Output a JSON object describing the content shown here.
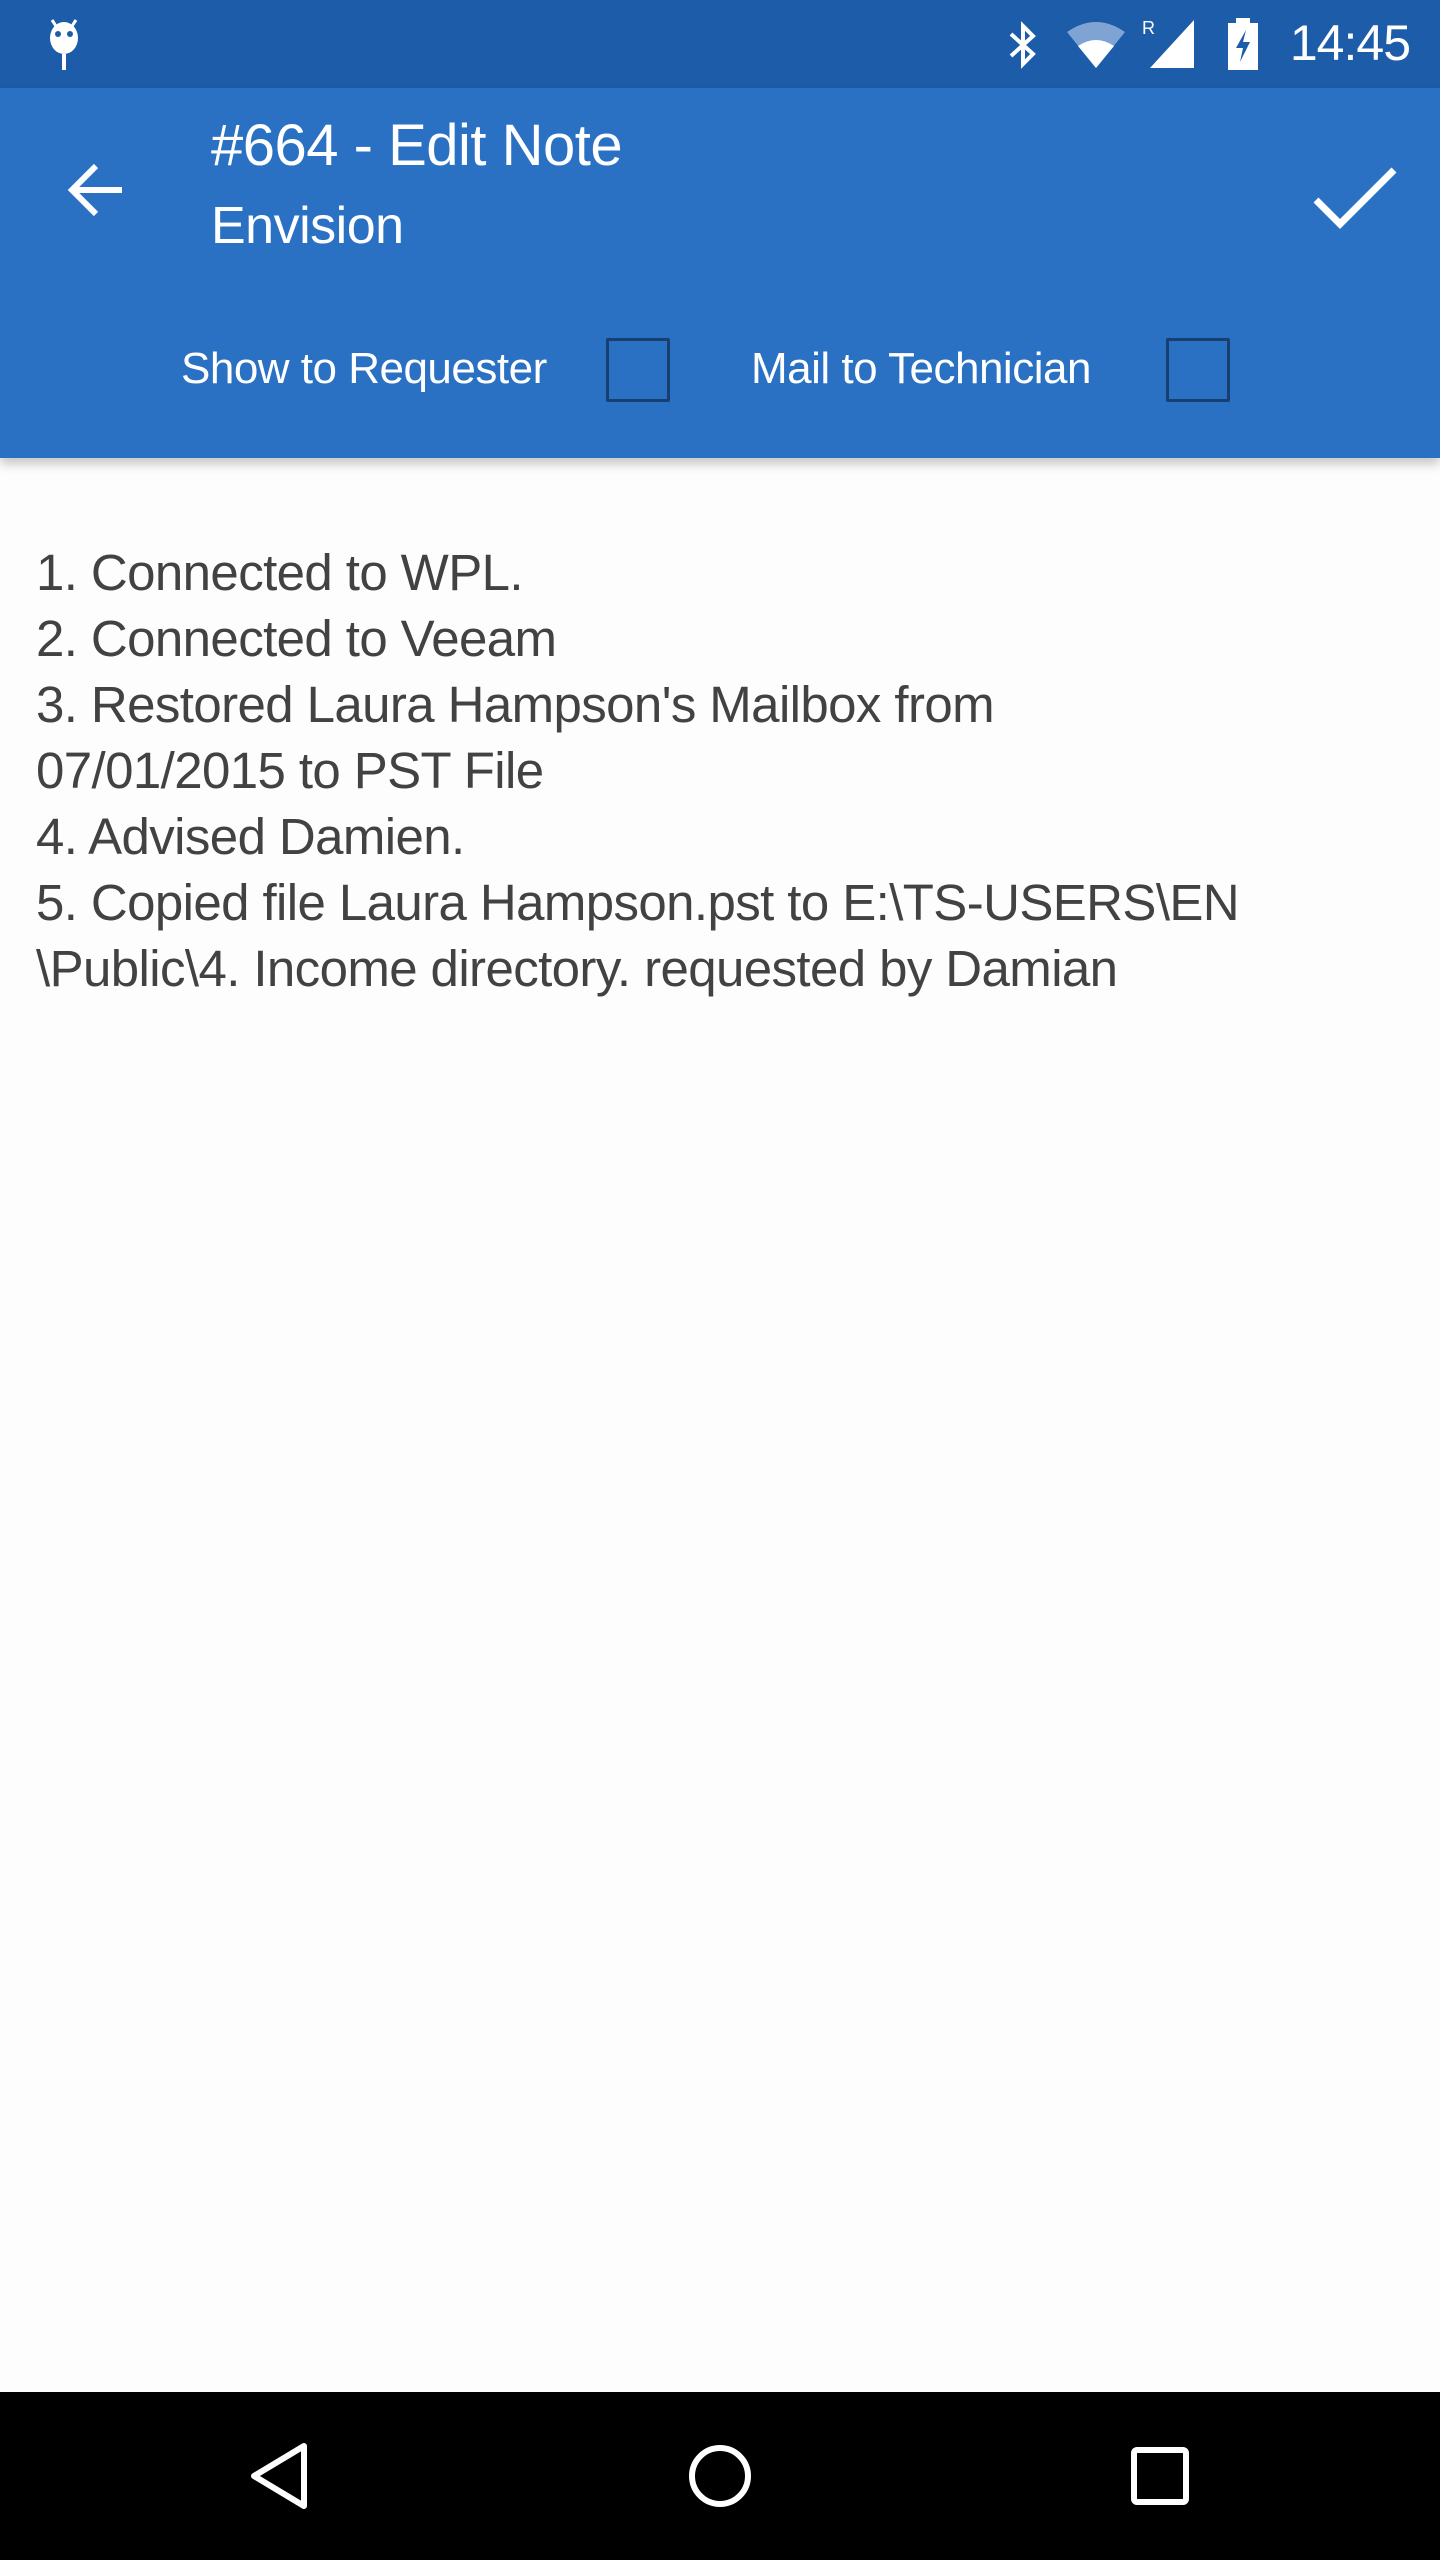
{
  "status_bar": {
    "time": "14:45",
    "icons": [
      "android-debug-icon",
      "bluetooth-icon",
      "wifi-icon",
      "signal-roaming-icon",
      "battery-charging-icon"
    ]
  },
  "toolbar": {
    "title": "#664 - Edit Note",
    "subtitle": "Envision",
    "back_icon": "arrow-left-icon",
    "save_icon": "check-icon",
    "show_to_requester_label": "Show to Requester",
    "show_to_requester_checked": false,
    "mail_to_technician_label": "Mail to Technician",
    "mail_to_technician_checked": false
  },
  "note": {
    "lines": [
      "1. Connected to WPL.",
      "2. Connected to Veeam",
      "3. Restored Laura Hampson's Mailbox from",
      "07/01/2015 to PST File",
      "4. Advised Damien.",
      "5. Copied file Laura Hampson.pst to E:\\TS-USERS\\EN",
      "\\Public\\4. Income directory. requested by Damian"
    ]
  },
  "colors": {
    "status_bar": "#1c5ca9",
    "toolbar": "#2a71c4",
    "text": "#424242"
  }
}
